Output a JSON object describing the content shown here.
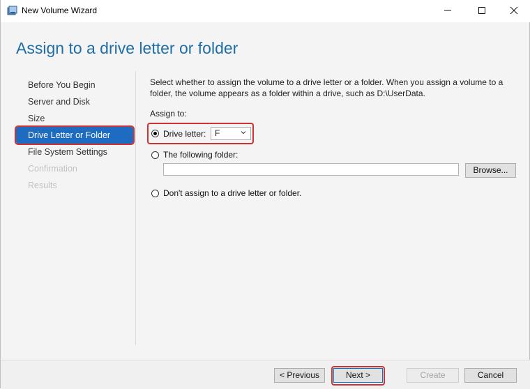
{
  "window": {
    "title": "New Volume Wizard",
    "icons": {
      "app": "disk-manager-icon",
      "minimize": "minimize-icon",
      "maximize": "maximize-icon",
      "close": "close-icon"
    }
  },
  "header": {
    "title": "Assign to a drive letter or folder"
  },
  "steps": [
    {
      "label": "Before You Begin",
      "state": "normal"
    },
    {
      "label": "Server and Disk",
      "state": "normal"
    },
    {
      "label": "Size",
      "state": "normal"
    },
    {
      "label": "Drive Letter or Folder",
      "state": "active"
    },
    {
      "label": "File System Settings",
      "state": "normal"
    },
    {
      "label": "Confirmation",
      "state": "disabled"
    },
    {
      "label": "Results",
      "state": "disabled"
    }
  ],
  "content": {
    "description": "Select whether to assign the volume to a drive letter or a folder. When you assign a volume to a folder, the volume appears as a folder within a drive, such as D:\\UserData.",
    "assign_label": "Assign to:",
    "options": {
      "drive_letter": {
        "label": "Drive letter:",
        "selected": true,
        "value": "F"
      },
      "folder": {
        "label": "The following folder:",
        "selected": false,
        "value": "",
        "browse_label": "Browse..."
      },
      "none": {
        "label": "Don't assign to a drive letter or folder.",
        "selected": false
      }
    }
  },
  "footer": {
    "previous_label": "< Previous",
    "next_label": "Next >",
    "create_label": "Create",
    "cancel_label": "Cancel"
  },
  "colors": {
    "accent": "#1e6bc2",
    "header_text": "#1e6ea7",
    "annotation": "#d03131"
  }
}
